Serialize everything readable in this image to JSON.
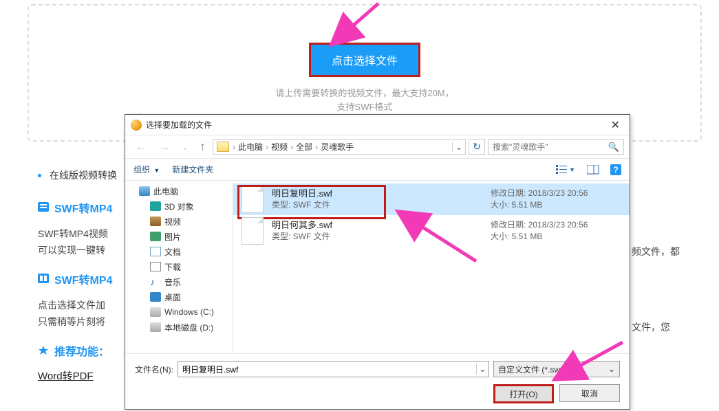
{
  "upload": {
    "button": "点击选择文件",
    "hint1": "请上传需要转换的视频文件，最大支持20M，",
    "hint2": "支持SWF格式"
  },
  "left": {
    "bullet": "在线版视频转换",
    "h1": "SWF转MP4",
    "p1a": "SWF转MP4视频",
    "p1b": "可以实现一键转",
    "p1c": "频文件，都",
    "h2": "SWF转MP4",
    "p2a": "点击选择文件加",
    "p2b": "只需稍等片刻将",
    "p2c": "文件，您",
    "h3": "推荐功能：",
    "link": "Word转PDF"
  },
  "dialog": {
    "title": "选择要加载的文件",
    "breadcrumb": [
      "此电脑",
      "视频",
      "全部",
      "灵魂歌手"
    ],
    "search_placeholder": "搜索\"灵魂歌手\"",
    "org": "组织",
    "new_folder": "新建文件夹",
    "sidebar": {
      "pc": "此电脑",
      "items": [
        {
          "icon": "3d",
          "label": "3D 对象"
        },
        {
          "icon": "video",
          "label": "视频"
        },
        {
          "icon": "img",
          "label": "图片"
        },
        {
          "icon": "doc",
          "label": "文档"
        },
        {
          "icon": "dl",
          "label": "下载"
        },
        {
          "icon": "music",
          "label": "音乐"
        },
        {
          "icon": "desktop",
          "label": "桌面"
        },
        {
          "icon": "disk",
          "label": "Windows (C:)"
        },
        {
          "icon": "disk",
          "label": "本地磁盘 (D:)"
        }
      ]
    },
    "files": [
      {
        "name": "明日复明日.swf",
        "type": "类型: SWF 文件",
        "date_label": "修改日期:",
        "date": "2018/3/23 20:56",
        "size_label": "大小:",
        "size": "5.51 MB",
        "selected": true,
        "highlighted": true
      },
      {
        "name": "明日何其多.swf",
        "type": "类型: SWF 文件",
        "date_label": "修改日期:",
        "date": "2018/3/23 20:56",
        "size_label": "大小:",
        "size": "5.51 MB",
        "selected": false,
        "highlighted": false
      }
    ],
    "filename_label": "文件名(N):",
    "filename_value": "明日复明日.swf",
    "filter": "自定义文件 (*.swf)",
    "open_btn": "打开(O)",
    "cancel_btn": "取消"
  }
}
